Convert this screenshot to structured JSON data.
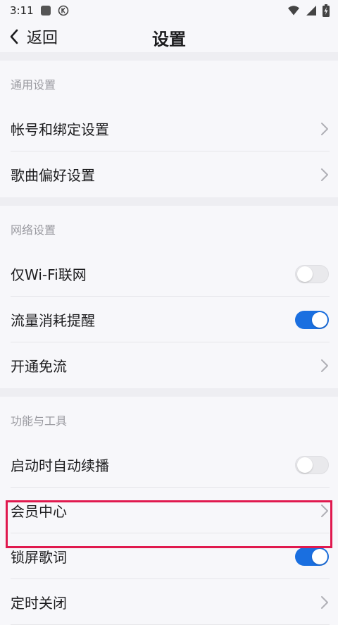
{
  "status_bar": {
    "time": "3:11",
    "icons": [
      "notification-square-icon",
      "k-circle-icon",
      "wifi-icon",
      "cell-signal-icon",
      "battery-charging-icon"
    ]
  },
  "nav": {
    "back_label": "返回",
    "title": "设置"
  },
  "sections": [
    {
      "header": "通用设置",
      "items": [
        {
          "label": "帐号和绑定设置",
          "control": "chevron"
        },
        {
          "label": "歌曲偏好设置",
          "control": "chevron"
        }
      ]
    },
    {
      "header": "网络设置",
      "items": [
        {
          "label": "仅Wi-Fi联网",
          "control": "toggle",
          "state": "off"
        },
        {
          "label": "流量消耗提醒",
          "control": "toggle",
          "state": "on"
        },
        {
          "label": "开通免流",
          "control": "chevron"
        }
      ]
    },
    {
      "header": "功能与工具",
      "items": [
        {
          "label": "启动时自动续播",
          "control": "toggle",
          "state": "off"
        },
        {
          "label": "会员中心",
          "control": "chevron"
        },
        {
          "label": "锁屏歌词",
          "control": "toggle",
          "state": "on",
          "highlighted": true
        },
        {
          "label": "定时关闭",
          "control": "chevron"
        }
      ]
    }
  ],
  "colors": {
    "background": "#f7f7fa",
    "section_gap": "#eeeef2",
    "toggle_on": "#1a6fe0",
    "toggle_off": "#e9e9ec",
    "highlight": "#e0194e",
    "header_text": "#9a9aa0"
  }
}
